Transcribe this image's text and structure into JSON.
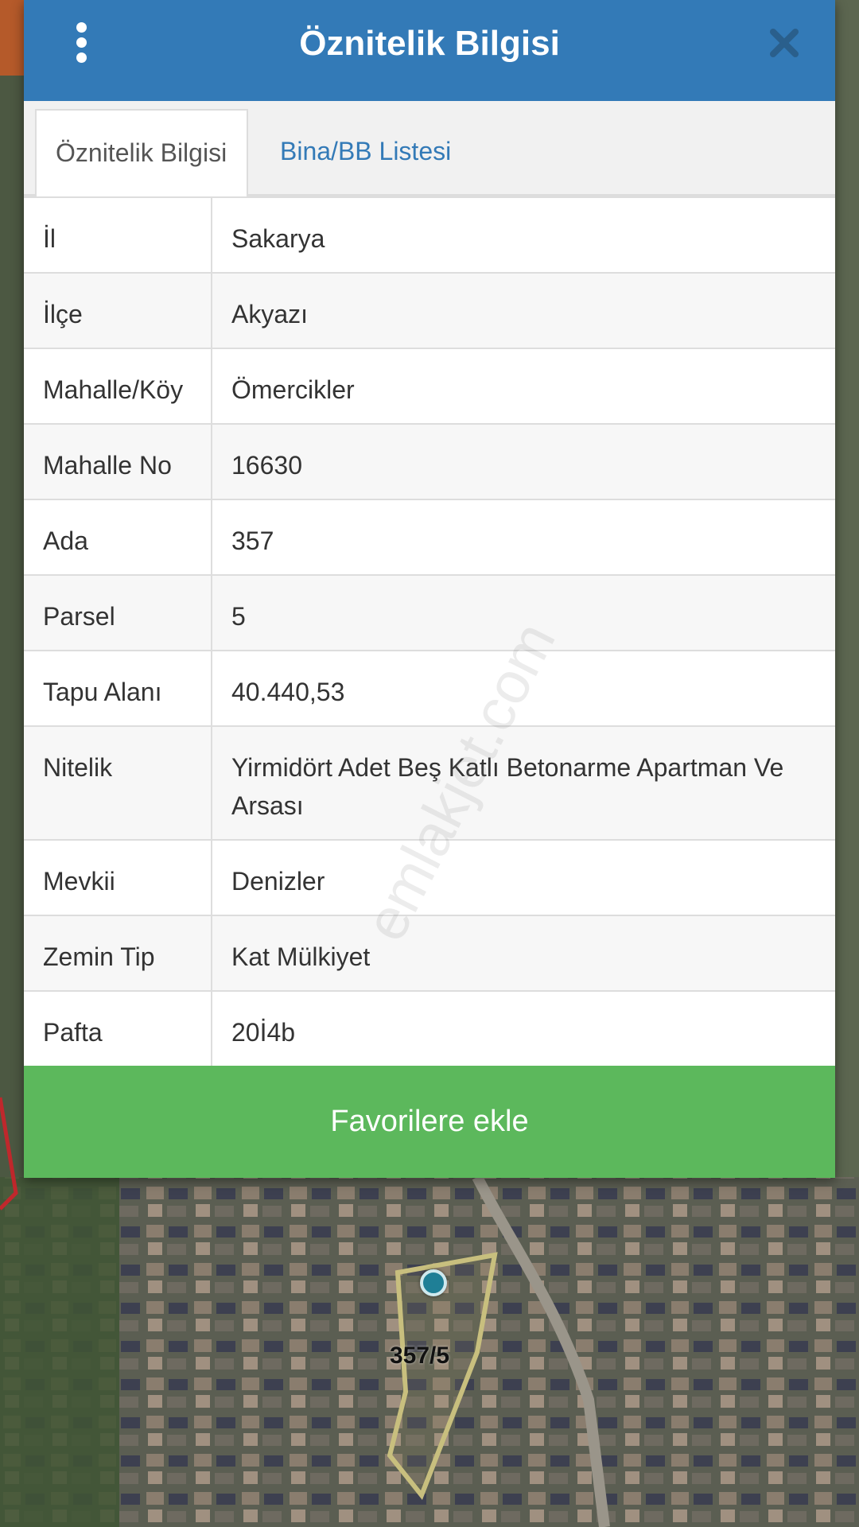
{
  "header": {
    "title": "Öznitelik Bilgisi"
  },
  "tabs": [
    {
      "label": "Öznitelik Bilgisi",
      "active": true
    },
    {
      "label": "Bina/BB Listesi",
      "active": false
    }
  ],
  "attributes": [
    {
      "key": "İl",
      "value": "Sakarya"
    },
    {
      "key": "İlçe",
      "value": "Akyazı"
    },
    {
      "key": "Mahalle/Köy",
      "value": "Ömercikler"
    },
    {
      "key": "Mahalle No",
      "value": "16630"
    },
    {
      "key": "Ada",
      "value": "357"
    },
    {
      "key": "Parsel",
      "value": "5"
    },
    {
      "key": "Tapu Alanı",
      "value": "40.440,53"
    },
    {
      "key": "Nitelik",
      "value": "Yirmidört Adet Beş Katlı Betonarme Apartman Ve Arsası"
    },
    {
      "key": "Mevkii",
      "value": "Denizler"
    },
    {
      "key": "Zemin Tip",
      "value": "Kat Mülkiyet"
    },
    {
      "key": "Pafta",
      "value": "20İ4b"
    }
  ],
  "favorite_button": "Favorilere ekle",
  "map": {
    "parcel_label": "357/5"
  },
  "watermark": "emlakjet.com",
  "colors": {
    "header": "#337ab7",
    "link": "#337ab7",
    "favorite": "#5cb85c"
  }
}
